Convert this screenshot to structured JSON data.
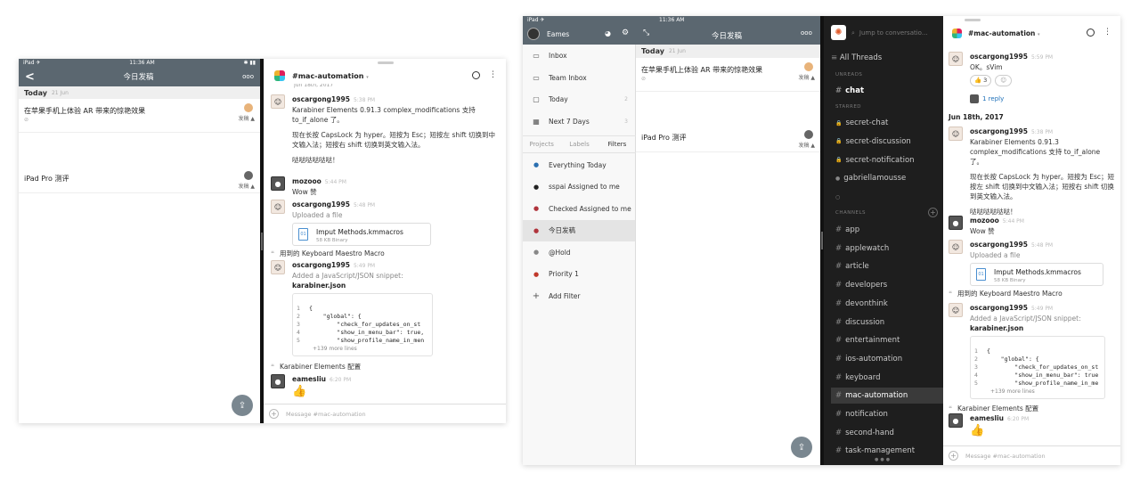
{
  "left_screen": {
    "status_bar": {
      "left": "iPad ✈",
      "time": "11:36 AM",
      "right": "✱ ▮▮"
    },
    "nav": {
      "back": "<",
      "title": "今日发稿",
      "more": "ooo"
    },
    "section": {
      "label": "Today",
      "date": "21 Jun"
    },
    "tasks": [
      {
        "title": "在苹果手机上体验 AR 带来的惊艳效果",
        "assignee": "发稿 ▲",
        "clip": "⊘"
      },
      {
        "title": "iPad Pro 测评",
        "assignee": "发稿 ▲",
        "clip": ""
      }
    ],
    "fab_icon": "quick-add-icon"
  },
  "left_slack": {
    "channel": "#mac-automation",
    "channel_caret": "▾",
    "truncated_top": "Jun 18th, 2017",
    "messages": [
      {
        "user": "oscargong1995",
        "time": "5:38 PM",
        "text": "Karabiner Elements 0.91.3  complex_modifications 支持 to_if_alone 了。",
        "text2": "现在长按 CapsLock 为 hyper。短按为 Esc；短按左 shift 切换到中文输入法；短按右 shift 切换到英文输入法。",
        "text3": "哒哒哒哒哒哒！"
      },
      {
        "user": "mozooo",
        "time": "5:44 PM",
        "text": "Wow 赞"
      },
      {
        "user": "oscargong1995",
        "time": "5:48 PM",
        "text": "Uploaded a file",
        "file_name": "Imput Methods.kmmacros",
        "file_size": "58 KB Binary",
        "comment": "用到的 Keyboard Maestro Macro"
      },
      {
        "user": "oscargong1995",
        "time": "5:49 PM",
        "text": "Added a JavaScript/JSON snippet:",
        "snippet_name": "karabiner.json",
        "code": [
          "{",
          "    \"global\": {",
          "        \"check_for_updates_on_st",
          "        \"show_in_menu_bar\": true,",
          "        \"show_profile_name_in_men"
        ],
        "more": "+139 more lines",
        "comment": "Karabiner Elements 配置"
      },
      {
        "user": "eamesliu",
        "time": "6:20 PM",
        "emoji": "👍"
      }
    ],
    "composer_placeholder": "Message #mac-automation"
  },
  "right_tasks": {
    "status_bar": {
      "left": "iPad ✈",
      "time": "11:36 AM"
    },
    "user": "Eames",
    "items": [
      {
        "label": "Inbox",
        "icon": "inbox-icon",
        "glyph": "▭",
        "count": ""
      },
      {
        "label": "Team Inbox",
        "icon": "team-inbox-icon",
        "glyph": "▭",
        "count": ""
      },
      {
        "label": "Today",
        "icon": "today-icon",
        "glyph": "▢",
        "count": "2"
      },
      {
        "label": "Next 7 Days",
        "icon": "calendar-icon",
        "glyph": "▦",
        "count": "3"
      }
    ],
    "tabs": [
      "Projects",
      "Labels",
      "Filters"
    ],
    "filters": [
      {
        "label": "Everything Today",
        "color": "#2a6fb0"
      },
      {
        "label": "sspai Assigned to me",
        "color": "#222222"
      },
      {
        "label": "Checked Assigned to me",
        "color": "#b0343c"
      },
      {
        "label": "今日发稿",
        "color": "#b0343c"
      },
      {
        "label": "@Hold",
        "color": "#888888"
      },
      {
        "label": "Priority 1",
        "color": "#c0392b"
      },
      {
        "label": "Add Filter",
        "color": "#555555"
      }
    ],
    "list_title": "今日发稿",
    "section": {
      "label": "Today",
      "date": "21 Jun"
    },
    "tasks": [
      {
        "title": "在苹果手机上体验 AR 带来的惊艳效果",
        "assignee": "发稿 ▲"
      },
      {
        "title": "iPad Pro 测评",
        "assignee": "发稿 ▲"
      }
    ]
  },
  "slack_sidebar": {
    "search_placeholder": "Jump to conversatio...",
    "all_threads": "All Threads",
    "unreads_label": "UNREADS",
    "unreads": [
      "chat"
    ],
    "starred_label": "STARRED",
    "starred": [
      {
        "name": "secret-chat",
        "glyph": "🔒"
      },
      {
        "name": "secret-discussion",
        "glyph": "🔒"
      },
      {
        "name": "secret-notification",
        "glyph": "🔒"
      },
      {
        "name": "gabriellamousse",
        "glyph": "●"
      },
      {
        "name": "",
        "glyph": "○"
      }
    ],
    "channels_label": "CHANNELS",
    "channels": [
      "app",
      "applewatch",
      "article",
      "developers",
      "devonthink",
      "discussion",
      "entertainment",
      "ios-automation",
      "keyboard",
      "mac-automation",
      "notification",
      "second-hand",
      "task-management"
    ],
    "active_channel": "mac-automation"
  },
  "right_slack": {
    "channel": "#mac-automation",
    "channel_caret": "▾",
    "top_msg": {
      "user": "oscargong1995",
      "time": "5:59 PM",
      "text": "OK。sVim",
      "reaction1": "👍 3",
      "reaction2": "☺",
      "replies": "1 reply"
    },
    "date_divider": "Jun 18th, 2017",
    "messages": [
      {
        "user": "oscargong1995",
        "time": "5:38 PM",
        "text": "Karabiner Elements 0.91.3",
        "text_b": "complex_modifications 支持 to_if_alone 了。",
        "text2": "现在长按 CapsLock 为 hyper。短按为 Esc；短按左 shift 切换到中文输入法；短按右 shift 切换到英文输入法。",
        "text3": "哒哒哒哒哒哒！"
      },
      {
        "user": "mozooo",
        "time": "5:44 PM",
        "text": "Wow 赞"
      },
      {
        "user": "oscargong1995",
        "time": "5:48 PM",
        "text": "Uploaded a file",
        "file_name": "Imput Methods.kmmacros",
        "file_size": "58 KB Binary",
        "comment": "用到的 Keyboard Maestro Macro"
      },
      {
        "user": "oscargong1995",
        "time": "5:49 PM",
        "text": "Added a JavaScript/JSON snippet:",
        "snippet_name": "karabiner.json",
        "code": [
          "{",
          "    \"global\": {",
          "        \"check_for_updates_on_st",
          "        \"show_in_menu_bar\": true",
          "        \"show_profile_name_in_me"
        ],
        "more": "+139 more lines",
        "comment": "Karabiner Elements 配置"
      },
      {
        "user": "eamesliu",
        "time": "6:20 PM",
        "emoji": "👍"
      }
    ],
    "composer_placeholder": "Message #mac-automation"
  },
  "colors": {
    "ios_nav": "#5b6770",
    "slack_dark": "#1e1e1e",
    "active_channel": "#3a3a3a",
    "selected_filter": "#e4e4e4"
  }
}
